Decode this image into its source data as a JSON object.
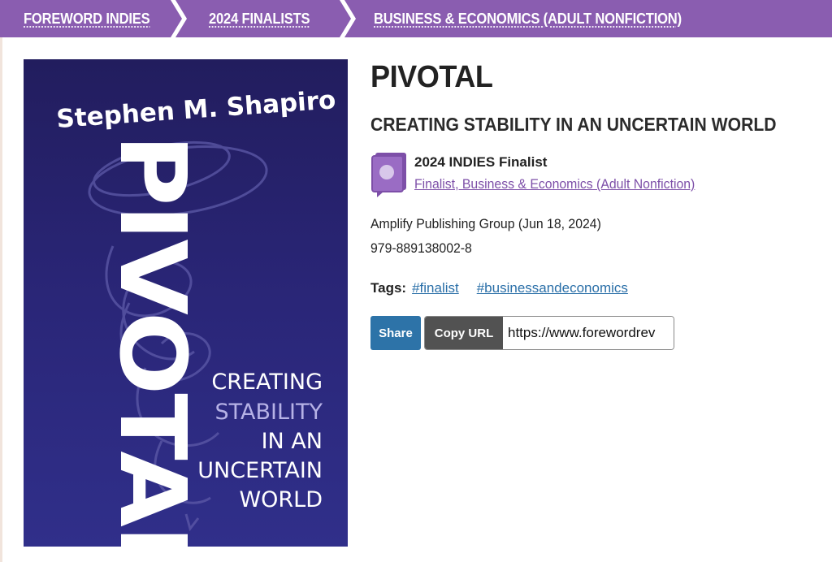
{
  "breadcrumb": {
    "items": [
      {
        "label": "FOREWORD INDIES"
      },
      {
        "label": "2024 FINALISTS"
      },
      {
        "label": "BUSINESS & ECONOMICS (ADULT NONFICTION)"
      }
    ]
  },
  "cover": {
    "author": "Stephen M. Shapiro",
    "title": "PIVOTAL",
    "tagline_lines": [
      "CREATING",
      "STABILITY",
      "IN AN",
      "UNCERTAIN",
      "WORLD"
    ]
  },
  "book": {
    "title": "PIVOTAL",
    "subtitle": "CREATING STABILITY IN AN UNCERTAIN WORLD",
    "award_title": "2024 INDIES Finalist",
    "award_link": "Finalist, Business & Economics (Adult Nonfiction)",
    "publisher": "Amplify Publishing Group (Jun 18, 2024)",
    "isbn": "979-889138002-8"
  },
  "tags": {
    "label": "Tags:",
    "items": [
      "#finalist",
      "#businessandeconomics"
    ]
  },
  "share": {
    "share_label": "Share",
    "copy_label": "Copy URL",
    "url_value": "https://www.forewordrev"
  },
  "colors": {
    "brand_purple": "#8a5db0",
    "link_purple": "#7d4fa8",
    "tag_blue": "#2a6fa8",
    "share_blue": "#2d73a8",
    "copy_gray": "#525252",
    "cover_navy": "#2a2678"
  }
}
